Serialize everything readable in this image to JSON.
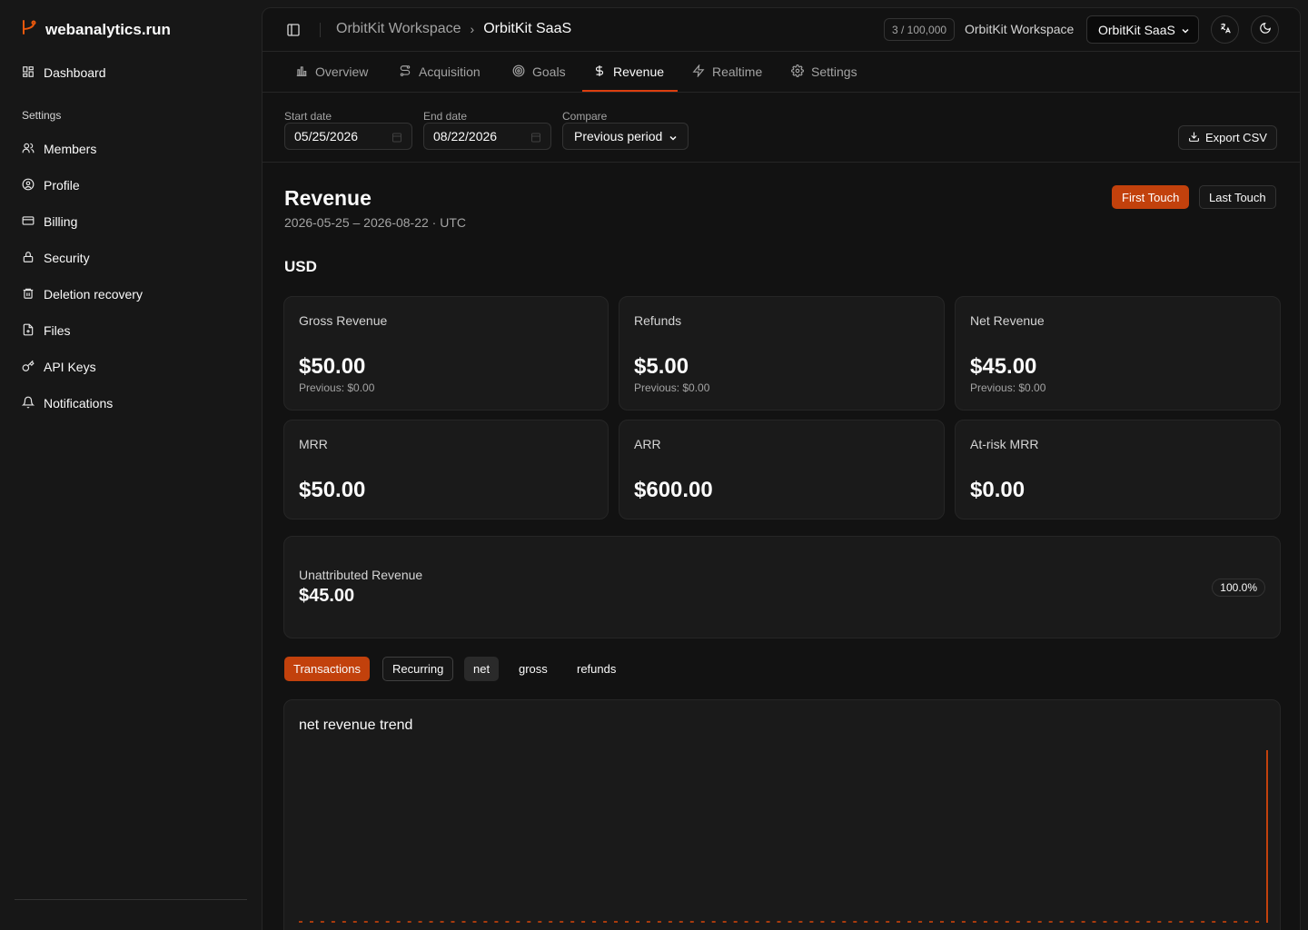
{
  "brand": {
    "name": "webanalytics.run",
    "icon": "branch-logo-icon",
    "accent": "#ea580c"
  },
  "sidebar": {
    "dashboard": "Dashboard",
    "section_label": "Settings",
    "items": [
      {
        "label": "Members",
        "icon": "users-icon"
      },
      {
        "label": "Profile",
        "icon": "user-circle-icon"
      },
      {
        "label": "Billing",
        "icon": "credit-card-icon"
      },
      {
        "label": "Security",
        "icon": "lock-icon"
      },
      {
        "label": "Deletion recovery",
        "icon": "trash-icon"
      },
      {
        "label": "Files",
        "icon": "file-icon"
      },
      {
        "label": "API Keys",
        "icon": "key-icon"
      },
      {
        "label": "Notifications",
        "icon": "bell-icon"
      }
    ]
  },
  "header": {
    "breadcrumb_workspace": "OrbitKit Workspace",
    "breadcrumb_project": "OrbitKit SaaS",
    "usage": "3 / 100,000",
    "workspace_label": "OrbitKit Workspace",
    "project_select": "OrbitKit SaaS"
  },
  "tabs": [
    {
      "label": "Overview",
      "icon": "bar-chart-icon",
      "active": false
    },
    {
      "label": "Acquisition",
      "icon": "route-icon",
      "active": false
    },
    {
      "label": "Goals",
      "icon": "target-icon",
      "active": false
    },
    {
      "label": "Revenue",
      "icon": "dollar-icon",
      "active": true
    },
    {
      "label": "Realtime",
      "icon": "zap-icon",
      "active": false
    },
    {
      "label": "Settings",
      "icon": "gear-icon",
      "active": false
    }
  ],
  "filters": {
    "start_label": "Start date",
    "start_value": "05/25/2026",
    "end_label": "End date",
    "end_value": "08/22/2026",
    "compare_label": "Compare",
    "compare_value": "Previous period",
    "export_label": "Export CSV"
  },
  "revenue": {
    "title": "Revenue",
    "range": "2026-05-25 – 2026-08-22 · UTC",
    "first_touch": "First Touch",
    "last_touch": "Last Touch",
    "currency": "USD"
  },
  "metrics": [
    {
      "label": "Gross Revenue",
      "value": "$50.00",
      "previous": "Previous: $0.00"
    },
    {
      "label": "Refunds",
      "value": "$5.00",
      "previous": "Previous: $0.00"
    },
    {
      "label": "Net Revenue",
      "value": "$45.00",
      "previous": "Previous: $0.00"
    },
    {
      "label": "MRR",
      "value": "$50.00"
    },
    {
      "label": "ARR",
      "value": "$600.00"
    },
    {
      "label": "At-risk MRR",
      "value": "$0.00"
    }
  ],
  "unattributed": {
    "label": "Unattributed Revenue",
    "value": "$45.00",
    "percent": "100.0%"
  },
  "toggles": {
    "transactions": "Transactions",
    "recurring": "Recurring",
    "net": "net",
    "gross": "gross",
    "refunds": "refunds"
  },
  "chart_data": {
    "type": "bar",
    "title": "net revenue trend",
    "series_color": "#c2410c",
    "n_days": 90,
    "nonzero": [
      {
        "index": 89,
        "value": 45
      }
    ],
    "ylim": [
      0,
      45
    ]
  }
}
